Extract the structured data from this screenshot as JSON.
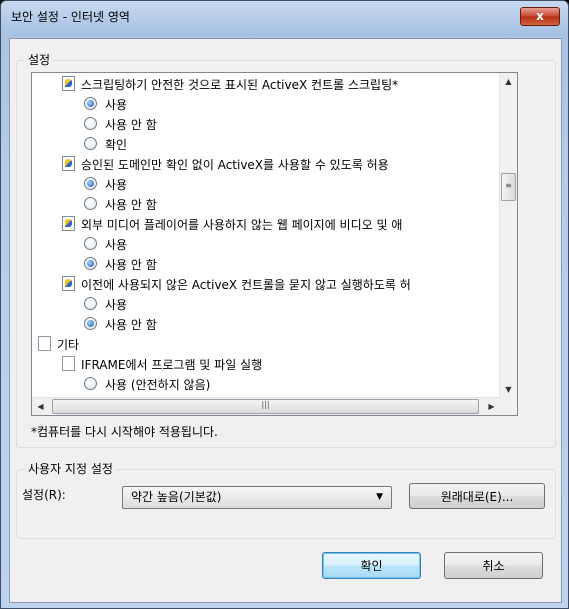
{
  "window": {
    "title": "보안 설정 - 인터넷 영역",
    "close_label": "x"
  },
  "settings_group": {
    "label": "설정",
    "rows": [
      {
        "kind": "setting",
        "text": "스크립팅하기 안전한 것으로 표시된 ActiveX 컨트롤 스크립팅*",
        "indent": 1
      },
      {
        "kind": "radio",
        "text": "사용",
        "selected": true,
        "indent": 2
      },
      {
        "kind": "radio",
        "text": "사용 안 함",
        "selected": false,
        "indent": 2
      },
      {
        "kind": "radio",
        "text": "확인",
        "selected": false,
        "indent": 2
      },
      {
        "kind": "setting",
        "text": "승인된 도메인만 확인 없이 ActiveX를 사용할 수 있도록 허용",
        "indent": 1
      },
      {
        "kind": "radio",
        "text": "사용",
        "selected": true,
        "indent": 2
      },
      {
        "kind": "radio",
        "text": "사용 안 함",
        "selected": false,
        "indent": 2
      },
      {
        "kind": "setting",
        "text": "외부 미디어 플레이어를 사용하지 않는 웹 페이지에 비디오 및 애",
        "indent": 1
      },
      {
        "kind": "radio",
        "text": "사용",
        "selected": false,
        "indent": 2
      },
      {
        "kind": "radio",
        "text": "사용 안 함",
        "selected": true,
        "indent": 2
      },
      {
        "kind": "setting",
        "text": "이전에 사용되지 않은 ActiveX 컨트롤을 묻지 않고 실행하도록 허",
        "indent": 1
      },
      {
        "kind": "radio",
        "text": "사용",
        "selected": false,
        "indent": 2
      },
      {
        "kind": "radio",
        "text": "사용 안 함",
        "selected": true,
        "indent": 2
      },
      {
        "kind": "page",
        "text": "기타",
        "indent": 0
      },
      {
        "kind": "page",
        "text": "IFRAME에서 프로그램 및 파일 실행",
        "indent": 1
      },
      {
        "kind": "radio",
        "text": "사용 (안전하지 않음)",
        "selected": false,
        "indent": 2
      }
    ],
    "restart_note": "*컴퓨터를 다시 시작해야 적용됩니다."
  },
  "custom_group": {
    "label": "사용자 지정 설정",
    "reset_to_label": "설정(R):",
    "selected_level": "약간 높음(기본값)",
    "reset_button": "원래대로(E)..."
  },
  "footer": {
    "ok": "확인",
    "cancel": "취소"
  },
  "icons": {
    "scroll_up": "▲",
    "scroll_down": "▼",
    "scroll_left": "◀",
    "scroll_right": "▶",
    "dropdown": "▼",
    "grip_v": "≡",
    "grip_h": "|||"
  }
}
